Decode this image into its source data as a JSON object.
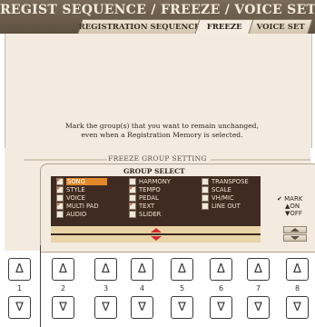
{
  "screen": {
    "title": "REGIST SEQUENCE / FREEZE / VOICE SET",
    "tabs": [
      {
        "label": "REGISTRATION SEQUENCE",
        "active": false
      },
      {
        "label": "FREEZE",
        "active": true
      },
      {
        "label": "VOICE SET",
        "active": false
      }
    ],
    "message_line1": "Mark the group(s) that you want to remain unchanged,",
    "message_line2": "even when a Registration Memory is selected.",
    "section_label": "FREEZE GROUP SETTING",
    "group_select_label": "GROUP SELECT",
    "groups": [
      {
        "label": "SONG",
        "checked": true,
        "selected": true
      },
      {
        "label": "STYLE",
        "checked": true,
        "selected": false
      },
      {
        "label": "VOICE",
        "checked": false,
        "selected": false
      },
      {
        "label": "MULTI PAD",
        "checked": true,
        "selected": false
      },
      {
        "label": "AUDIO",
        "checked": false,
        "selected": false
      },
      {
        "label": "HARMONY",
        "checked": false,
        "selected": false
      },
      {
        "label": "TEMPO",
        "checked": true,
        "selected": false
      },
      {
        "label": "PEDAL",
        "checked": false,
        "selected": false
      },
      {
        "label": "TEXT",
        "checked": true,
        "selected": false
      },
      {
        "label": "SLIDER",
        "checked": false,
        "selected": false
      },
      {
        "label": "TRANSPOSE",
        "checked": false,
        "selected": false
      },
      {
        "label": "SCALE",
        "checked": false,
        "selected": false
      },
      {
        "label": "VH/MIC",
        "checked": false,
        "selected": false
      },
      {
        "label": "LINE OUT",
        "checked": false,
        "selected": false
      }
    ],
    "mark_label": "MARK",
    "on_label": "ON",
    "off_label": "OFF"
  },
  "hardware": {
    "buttons": [
      "1",
      "2",
      "3",
      "4",
      "5",
      "6",
      "7",
      "8"
    ],
    "up_glyph": "Δ",
    "down_glyph": "∇"
  },
  "colors": {
    "selection": "#e2882b",
    "arrow": "#d32c2c",
    "list_bg": "#3f2b21"
  }
}
